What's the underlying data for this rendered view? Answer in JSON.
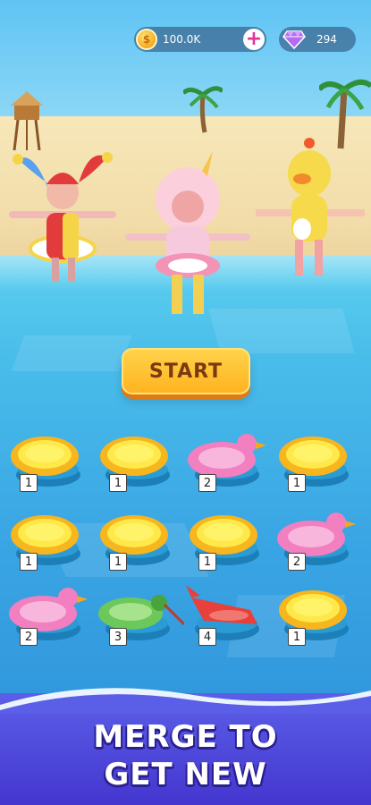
{
  "hud": {
    "coins_value": "100.0K",
    "coin_icon": "coin-icon",
    "gems_value": "294",
    "gem_icon": "diamond-icon",
    "add_icon": "plus-icon",
    "accent": "#e0339b"
  },
  "start_button": {
    "label": "START"
  },
  "characters": [
    {
      "name": "jester-character"
    },
    {
      "name": "pink-cat-character"
    },
    {
      "name": "chick-character"
    }
  ],
  "merge_grid": {
    "slots": [
      {
        "type": "yellow-raft",
        "level": "1"
      },
      {
        "type": "yellow-raft",
        "level": "1"
      },
      {
        "type": "pink-duck",
        "level": "2"
      },
      {
        "type": "yellow-raft",
        "level": "1"
      },
      {
        "type": "yellow-raft",
        "level": "1"
      },
      {
        "type": "yellow-raft",
        "level": "1"
      },
      {
        "type": "yellow-raft",
        "level": "1"
      },
      {
        "type": "pink-duck",
        "level": "2"
      },
      {
        "type": "pink-duck",
        "level": "2"
      },
      {
        "type": "green-hummingbird",
        "level": "3"
      },
      {
        "type": "red-fish",
        "level": "4"
      },
      {
        "type": "yellow-raft",
        "level": "1"
      }
    ]
  },
  "banner": {
    "line1": "MERGE TO",
    "line2": "GET NEW"
  }
}
